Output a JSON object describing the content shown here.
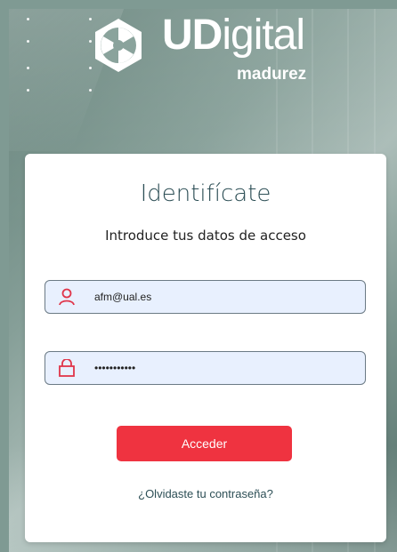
{
  "brand": {
    "name_bold": "UD",
    "name_light": "igital",
    "tagline": "madurez"
  },
  "login": {
    "title": "Identifícate",
    "subtitle": "Introduce tus datos de acceso",
    "email_value": "afm@ual.es",
    "password_value": "•••••••••••",
    "submit_label": "Acceder",
    "forgot_label": "¿Olvidaste tu contraseña?"
  },
  "colors": {
    "accent": "#ef3340",
    "title": "#2d4f56",
    "field_bg": "#e8f0fe",
    "icon": "#e0354a"
  },
  "icons": {
    "logo": "hexagon-pinwheel-logo",
    "user": "user-icon",
    "lock": "lock-icon"
  }
}
